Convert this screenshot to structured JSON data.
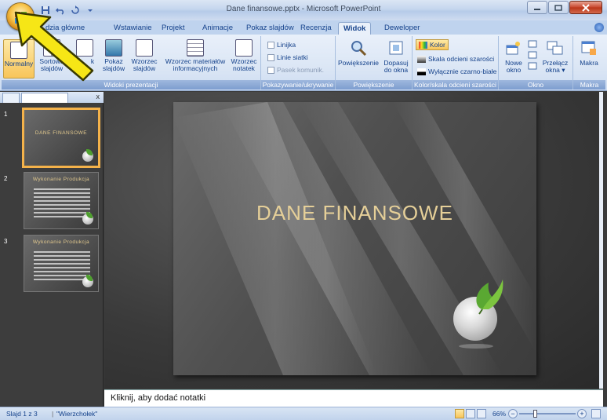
{
  "window": {
    "title": "Dane finansowe.pptx - Microsoft PowerPoint"
  },
  "tabs": [
    {
      "label": "Narzędzia główne"
    },
    {
      "label": "Wstawianie"
    },
    {
      "label": "Projekt"
    },
    {
      "label": "Animacje"
    },
    {
      "label": "Pokaz slajdów"
    },
    {
      "label": "Recenzja"
    },
    {
      "label": "Widok"
    },
    {
      "label": "Deweloper"
    }
  ],
  "tabs_visible_first": "dzia główne",
  "ribbon": {
    "views": {
      "label": "Widoki prezentacji",
      "normal": "Normalny",
      "sorter_1": "Sortowa",
      "sorter_2": "slajdów",
      "notes_1": "k",
      "show_1": "Pokaz",
      "show_2": "slajdów",
      "master_1": "Wzorzec",
      "master_2": "slajdów",
      "handout_1": "Wzorzec materiałów",
      "handout_2": "informacyjnych",
      "notesmaster_1": "Wzorzec",
      "notesmaster_2": "notatek"
    },
    "showhide": {
      "label": "Pokazywanie/ukrywanie",
      "ruler": "Linijka",
      "gridlines": "Linie siatki",
      "messagebar": "Pasek komunik."
    },
    "zoom": {
      "label": "Powiększenie",
      "zoom": "Powiększenie",
      "fit_1": "Dopasuj",
      "fit_2": "do okna"
    },
    "color": {
      "label": "Kolor/skala odcieni szarości",
      "color": "Kolor",
      "grayscale": "Skala odcieni szarości",
      "bw": "Wyłącznie czarno-białe"
    },
    "window": {
      "label": "Okno",
      "new_1": "Nowe",
      "new_2": "okno",
      "switch_1": "Przełącz",
      "switch_2": "okna ▾"
    },
    "macros": {
      "label": "Makra",
      "macros": "Makra"
    }
  },
  "slides": [
    {
      "num": "1",
      "title": "DANE FINANSOWE"
    },
    {
      "num": "2",
      "title": "Wykonanie Produkcja"
    },
    {
      "num": "3",
      "title": "Wykonanie Produkcja"
    }
  ],
  "slide": {
    "title": "DANE FINANSOWE"
  },
  "notes": {
    "placeholder": "Kliknij, aby dodać notatki"
  },
  "status": {
    "slide": "Slajd 1 z 3",
    "theme": "\"Wierzchołek\"",
    "zoom": "66%"
  },
  "colors": {
    "arrow": "#f6e616",
    "title_gold": "#e5cf98",
    "ribbon_blue": "#15428b"
  }
}
